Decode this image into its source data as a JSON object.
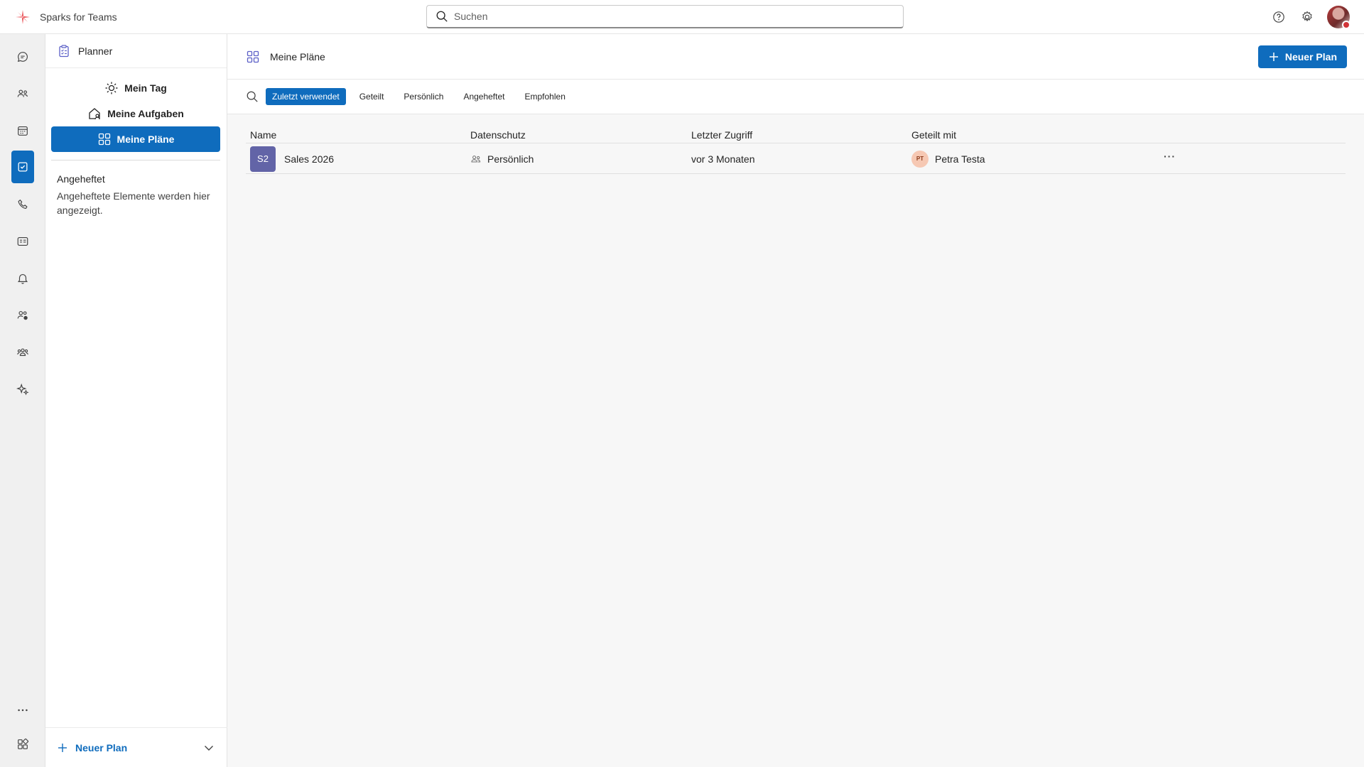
{
  "app": {
    "title": "Sparks for Teams"
  },
  "search": {
    "placeholder": "Suchen"
  },
  "rail": {
    "items": [
      {
        "icon": "chat-icon"
      },
      {
        "icon": "teams-icon"
      },
      {
        "icon": "calendar-icon"
      },
      {
        "icon": "planner-icon",
        "active": true
      },
      {
        "icon": "phone-icon"
      },
      {
        "icon": "contact-card-icon"
      },
      {
        "icon": "bell-icon"
      },
      {
        "icon": "people-settings-icon"
      },
      {
        "icon": "community-icon"
      },
      {
        "icon": "sparkle-icon"
      },
      {
        "icon": "more-icon"
      },
      {
        "icon": "apps-icon"
      }
    ]
  },
  "leftpane": {
    "title": "Planner",
    "nav": [
      {
        "label": "Mein Tag",
        "icon": "sun-icon"
      },
      {
        "label": "Meine Aufgaben",
        "icon": "home-person-icon"
      },
      {
        "label": "Meine Pläne",
        "icon": "grid-icon",
        "selected": true
      }
    ],
    "pinned_title": "Angeheftet",
    "pinned_text": "Angeheftete Elemente werden hier angezeigt.",
    "footer_label": "Neuer Plan"
  },
  "main": {
    "title": "Meine Pläne",
    "new_plan_label": "Neuer Plan",
    "filters": [
      {
        "label": "Zuletzt verwendet",
        "active": true
      },
      {
        "label": "Geteilt"
      },
      {
        "label": "Persönlich"
      },
      {
        "label": "Angeheftet"
      },
      {
        "label": "Empfohlen"
      }
    ],
    "table": {
      "headers": [
        "Name",
        "Datenschutz",
        "Letzter Zugriff",
        "Geteilt mit"
      ],
      "rows": [
        {
          "initials": "S2",
          "name": "Sales 2026",
          "privacy": "Persönlich",
          "last_access": "vor 3 Monaten",
          "shared_initials": "PT",
          "shared_with": "Petra Testa",
          "more": "···"
        }
      ]
    }
  },
  "colors": {
    "accent": "#0f6cbd",
    "plan_tile": "#6264a7",
    "presence_busy": "#d13438"
  }
}
